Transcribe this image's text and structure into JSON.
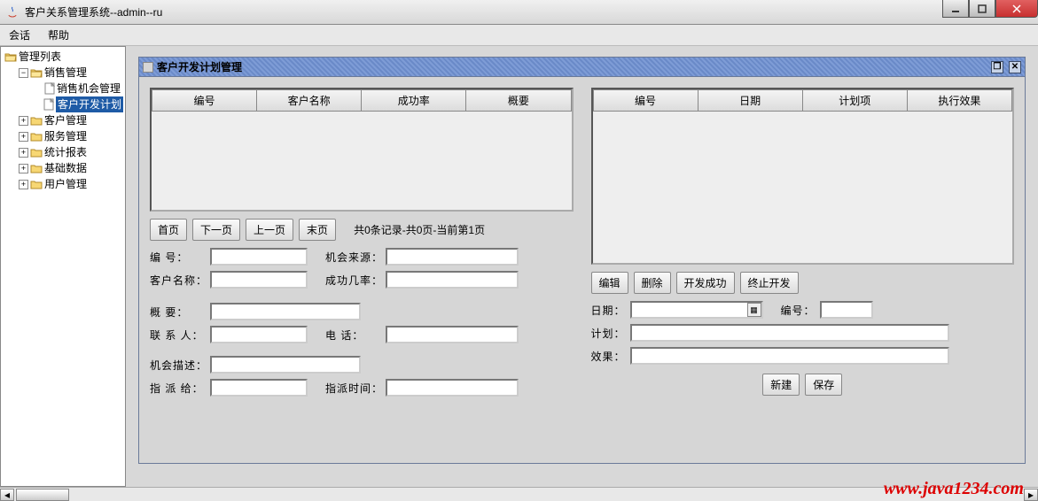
{
  "window": {
    "title": "客户关系管理系统--admin--ru"
  },
  "menu": {
    "session": "会话",
    "help": "帮助"
  },
  "tree": {
    "root": "管理列表",
    "sales": "销售管理",
    "sales_children": {
      "opportunity": "销售机会管理",
      "devplan": "客户开发计划"
    },
    "customer": "客户管理",
    "service": "服务管理",
    "stats": "统计报表",
    "basedata": "基础数据",
    "user": "用户管理"
  },
  "iframe": {
    "title": "客户开发计划管理",
    "restore": "❐",
    "close": "✕"
  },
  "left_table": {
    "cols": [
      "编号",
      "客户名称",
      "成功率",
      "概要"
    ]
  },
  "pager": {
    "first": "首页",
    "prev": "下一页",
    "next": "上一页",
    "last": "末页",
    "status": "共0条记录-共0页-当前第1页"
  },
  "left_form": {
    "id": "编    号：",
    "source": "机会来源：",
    "custname": "客户名称：",
    "success": "成功几率：",
    "summary": "概    要：",
    "contact": "联 系 人：",
    "phone": "电    话：",
    "desc": "机会描述：",
    "assign": "指 派 给：",
    "assigntime": "指派时间："
  },
  "right_table": {
    "cols": [
      "编号",
      "日期",
      "计划项",
      "执行效果"
    ]
  },
  "right_buttons": {
    "edit": "编辑",
    "delete": "删除",
    "success": "开发成功",
    "stop": "终止开发"
  },
  "right_form": {
    "date": "日期：",
    "id": "编号：",
    "plan": "计划：",
    "effect": "效果：",
    "new": "新建",
    "save": "保存"
  },
  "watermark": "www.java1234.com",
  "toggles": {
    "plus": "+",
    "minus": "−"
  }
}
